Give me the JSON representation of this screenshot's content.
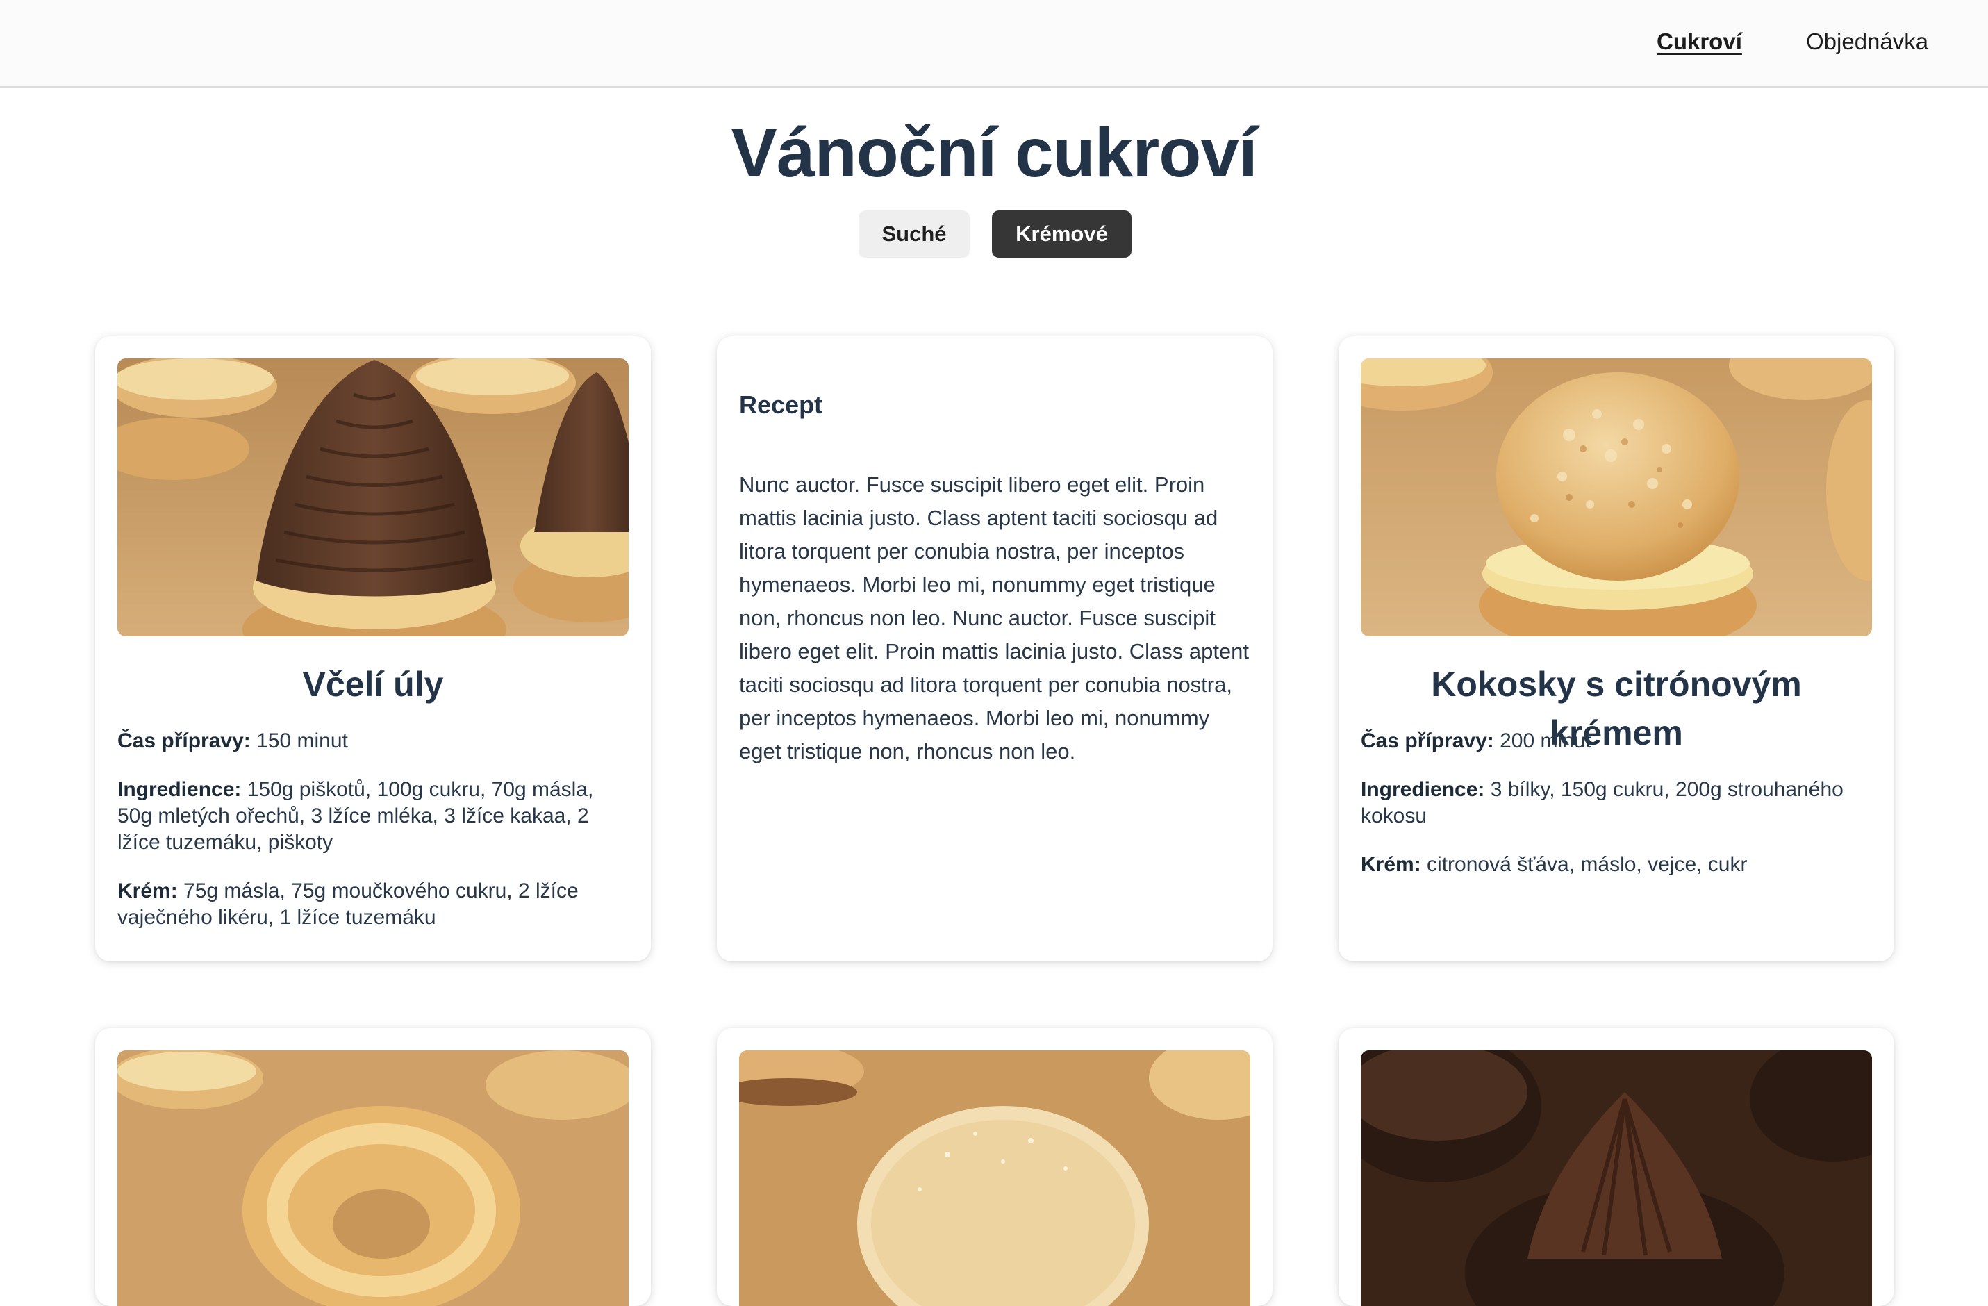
{
  "nav": {
    "items": [
      {
        "label": "Cukroví",
        "active": true
      },
      {
        "label": "Objednávka",
        "active": false
      }
    ]
  },
  "page": {
    "title": "Vánoční cukroví"
  },
  "filters": [
    {
      "label": "Suché",
      "selected": false
    },
    {
      "label": "Krémové",
      "selected": true
    }
  ],
  "cards": [
    {
      "image": "beehive-cookie-photo",
      "title": "Včelí úly",
      "time_label": "Čas přípravy:",
      "time_value": "150 minut",
      "ingredients_label": "Ingredience:",
      "ingredients_value": "150g piškotů, 100g cukru, 70g másla, 50g mletých ořechů, 3 lžíce mléka, 3 lžíce kakaa, 2 lžíce tuzemáku, piškoty",
      "cream_label": "Krém:",
      "cream_value": "75g másla, 75g moučkového cukru, 2 lžíce vaječného likéru, 1 lžíce tuzemáku"
    },
    {
      "heading": "Recept",
      "text": "Nunc auctor. Fusce suscipit libero eget elit. Proin mattis lacinia justo. Class aptent taciti sociosqu ad litora torquent per conubia nostra, per inceptos hymenaeos. Morbi leo mi, nonummy eget tristique non, rhoncus non leo. Nunc auctor. Fusce suscipit libero eget elit. Proin mattis lacinia justo. Class aptent taciti sociosqu ad litora torquent per conubia nostra, per inceptos hymenaeos. Morbi leo mi, nonummy eget tristique non, rhoncus non leo."
    },
    {
      "image": "coconut-macaroon-photo",
      "title": "Kokosky s citrónovým krémem",
      "time_label": "Čas přípravy:",
      "time_value": "200 minut",
      "ingredients_label": "Ingredience:",
      "ingredients_value": "3 bílky, 150g cukru, 200g strouhaného kokosu",
      "cream_label": "Krém:",
      "cream_value": "citronová šťáva, máslo, vejce, cukr"
    },
    {
      "image": "butter-ring-cookie-photo"
    },
    {
      "image": "sugar-donut-cookie-photo"
    },
    {
      "image": "chocolate-cream-tartlet-photo"
    }
  ],
  "colors": {
    "title_text": "#233449",
    "body_text": "#283848",
    "topbar_bg": "#fbfbfb",
    "filter_selected_bg": "#363636",
    "filter_unselected_bg": "#efefef",
    "photo_table": "#c99a5e"
  }
}
